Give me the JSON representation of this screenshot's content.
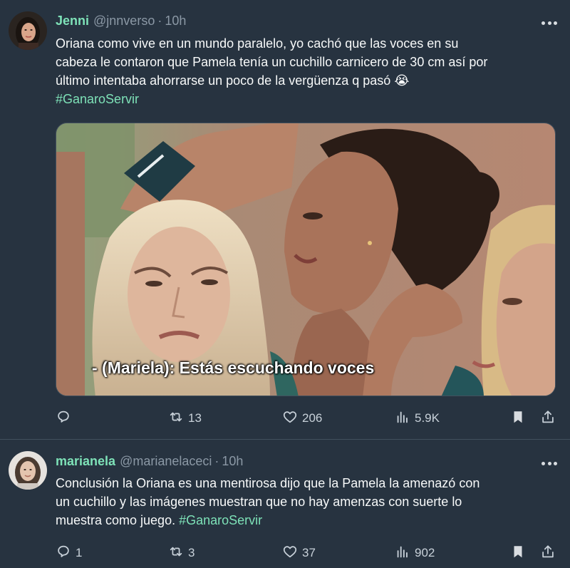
{
  "tweets": [
    {
      "name": "Jenni",
      "handle": "@jnnverso",
      "dot": "·",
      "time": "10h",
      "lines": [
        "Oriana como vive en un mundo paralelo, yo cachó que las voces en su",
        "cabeza le contaron que Pamela tenía un cuchillo carnicero de 30 cm así por",
        "último intentaba ahorrarse un poco de la vergüenza q pasó 😭"
      ],
      "hashtag": "#GanaroServir",
      "media_subtitle": "- (Mariela): Estás escuchando voces",
      "replies": "",
      "retweets": "13",
      "likes": "206",
      "views": "5.9K"
    },
    {
      "name": "marianela",
      "handle": "@marianelaceci",
      "dot": "·",
      "time": "10h",
      "lines": [
        "Conclusión la Oriana es una mentirosa dijo que la Pamela la amenazó con",
        "un cuchillo y las imágenes muestran que no hay amenzas con suerte lo"
      ],
      "last_line_text": "muestra como juego. ",
      "hashtag": "#GanaroServir",
      "replies": "1",
      "retweets": "3",
      "likes": "37",
      "views": "902"
    }
  ],
  "icons": {
    "reply": "reply-icon",
    "retweet": "retweet-icon",
    "like": "heart-icon",
    "views": "views-icon",
    "bookmark": "bookmark-icon",
    "share": "share-icon",
    "more": "more-icon"
  },
  "colors": {
    "background": "#273340",
    "accent": "#7ee2b8",
    "secondary_text": "#8b98a5"
  }
}
